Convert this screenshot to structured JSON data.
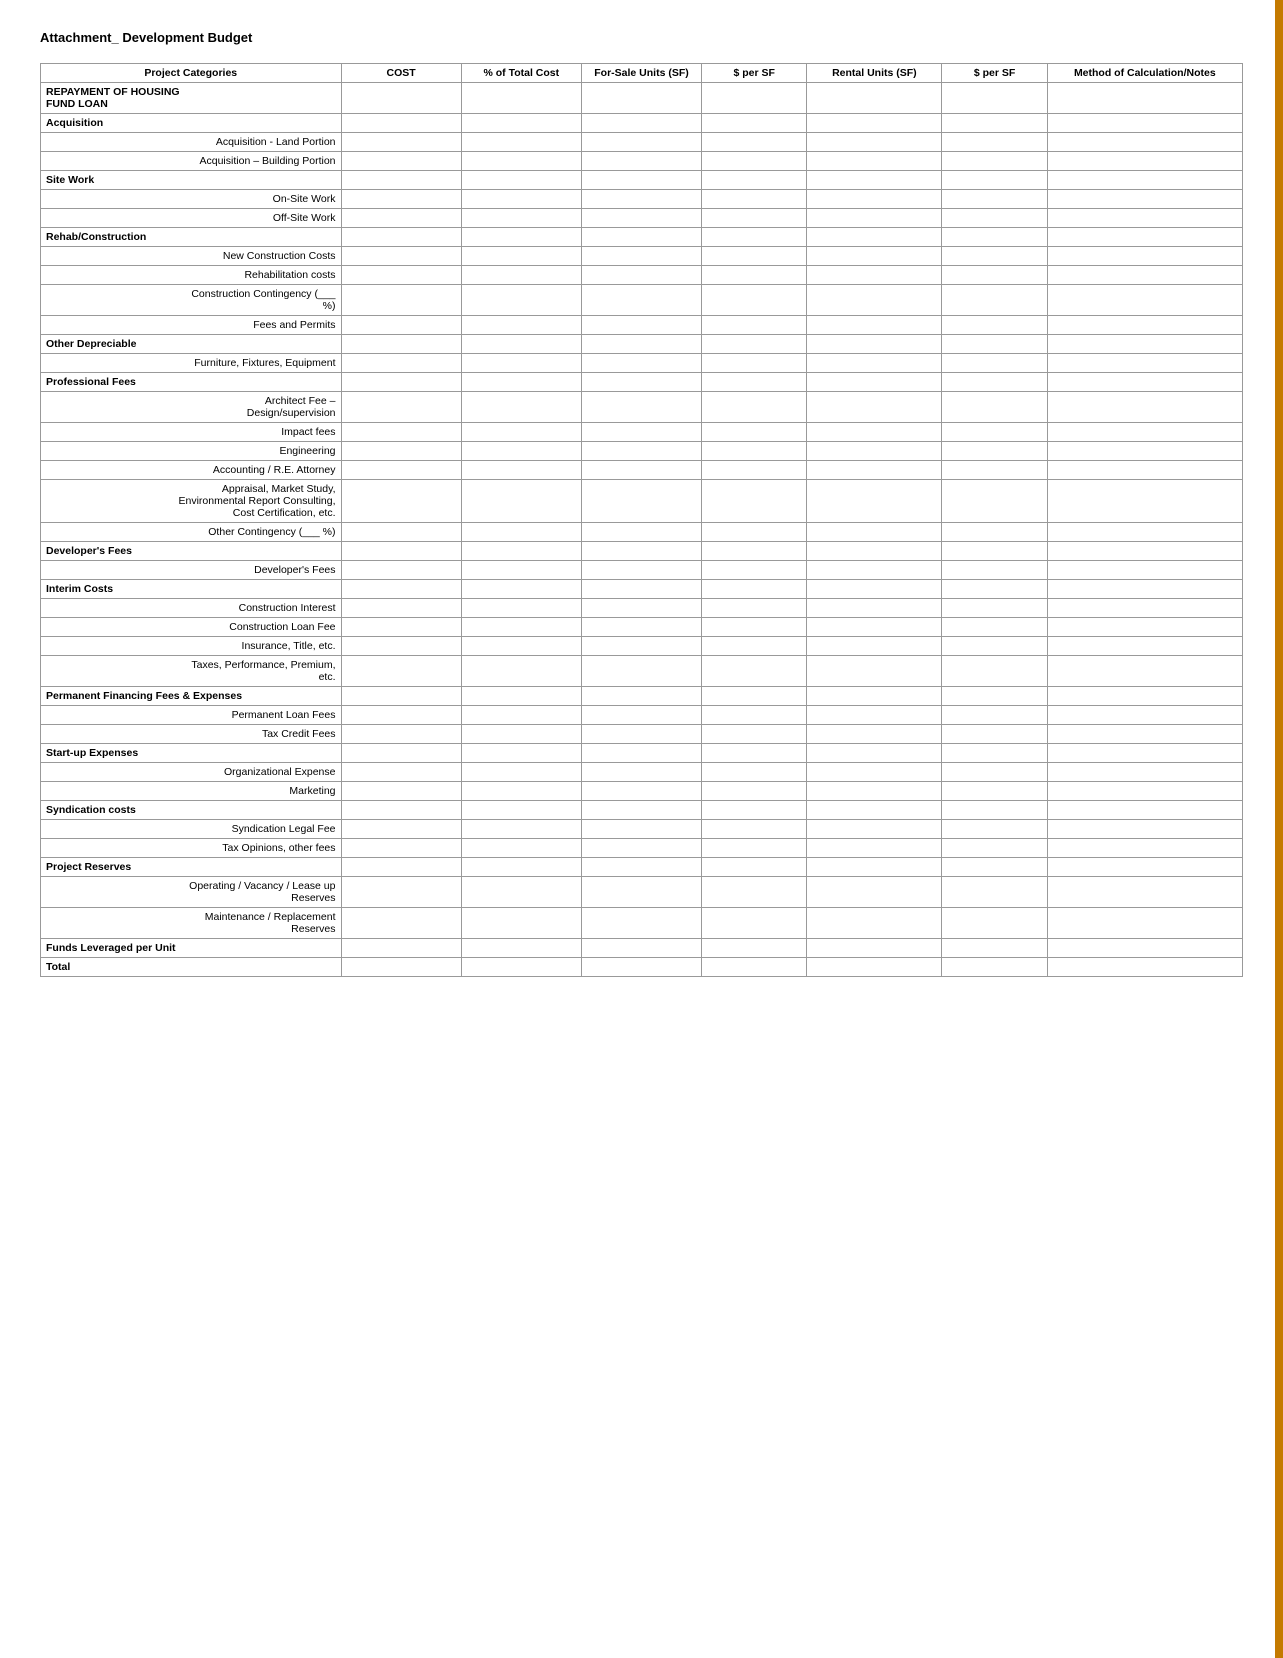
{
  "page": {
    "title": "Attachment_ Development Budget"
  },
  "table": {
    "headers": [
      "Project Categories",
      "COST",
      "% of Total Cost",
      "For-Sale Units (SF)",
      "$ per SF",
      "Rental Units (SF)",
      "$ per SF",
      "Method of Calculation/Notes"
    ],
    "sections": [
      {
        "label": "REPAYMENT OF HOUSING FUND LOAN",
        "type": "section",
        "rows": []
      },
      {
        "label": "Acquisition",
        "type": "section",
        "rows": [
          {
            "label": "Acquisition - Land Portion"
          },
          {
            "label": "Acquisition – Building Portion"
          }
        ]
      },
      {
        "label": "Site Work",
        "type": "section",
        "rows": [
          {
            "label": "On-Site Work"
          },
          {
            "label": "Off-Site Work"
          }
        ]
      },
      {
        "label": "Rehab/Construction",
        "type": "section",
        "rows": [
          {
            "label": "New Construction Costs"
          },
          {
            "label": "Rehabilitation costs"
          },
          {
            "label": "Construction Contingency (___\n%)"
          },
          {
            "label": "Fees and Permits"
          }
        ]
      },
      {
        "label": "Other Depreciable",
        "type": "section",
        "rows": [
          {
            "label": "Furniture, Fixtures, Equipment"
          }
        ]
      },
      {
        "label": "Professional Fees",
        "type": "section",
        "rows": [
          {
            "label": "Architect Fee –\nDesign/supervision"
          },
          {
            "label": "Impact fees"
          },
          {
            "label": "Engineering"
          },
          {
            "label": "Accounting / R.E. Attorney"
          },
          {
            "label": "Appraisal, Market Study,\nEnvironmental Report Consulting,\nCost Certification, etc."
          },
          {
            "label": "Other Contingency (___  %)"
          }
        ]
      },
      {
        "label": "Developer's Fees",
        "type": "section",
        "rows": [
          {
            "label": "Developer's Fees"
          }
        ]
      },
      {
        "label": "Interim Costs",
        "type": "section",
        "rows": [
          {
            "label": "Construction Interest"
          },
          {
            "label": "Construction Loan Fee"
          },
          {
            "label": "Insurance, Title, etc."
          },
          {
            "label": "Taxes, Performance, Premium,\netc."
          }
        ]
      },
      {
        "label": "Permanent Financing Fees & Expenses",
        "type": "section",
        "rows": [
          {
            "label": "Permanent Loan Fees"
          },
          {
            "label": "Tax Credit Fees"
          }
        ]
      },
      {
        "label": "Start-up Expenses",
        "type": "section",
        "rows": [
          {
            "label": "Organizational Expense"
          },
          {
            "label": "Marketing"
          }
        ]
      },
      {
        "label": "Syndication costs",
        "type": "section",
        "rows": [
          {
            "label": "Syndication Legal Fee"
          },
          {
            "label": "Tax Opinions, other fees"
          }
        ]
      },
      {
        "label": "Project Reserves",
        "type": "section",
        "rows": [
          {
            "label": "Operating / Vacancy /  Lease up\nReserves"
          },
          {
            "label": "Maintenance / Replacement\nReserves"
          }
        ]
      }
    ],
    "footer_rows": [
      {
        "label": "Funds Leveraged per Unit",
        "bold": true
      },
      {
        "label": "Total",
        "bold": true
      }
    ]
  }
}
